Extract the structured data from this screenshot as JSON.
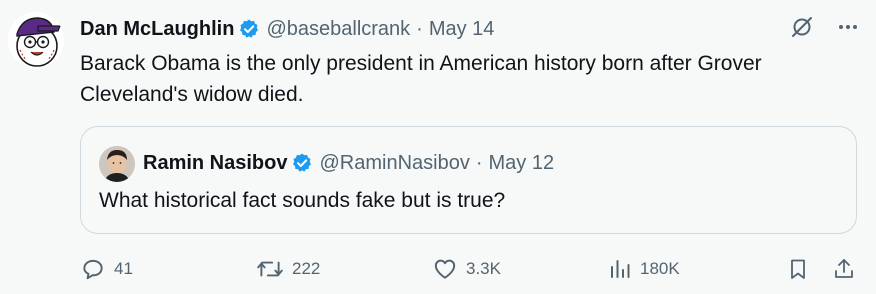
{
  "tweet": {
    "author_name": "Dan McLaughlin",
    "author_handle": "@baseballcrank",
    "separator": "·",
    "date": "May 14",
    "text": "Barack Obama is the only president in American history born after Grover Cleveland's widow died."
  },
  "quoted_tweet": {
    "author_name": "Ramin Nasibov",
    "author_handle": "@RaminNasibov",
    "separator": "·",
    "date": "May 12",
    "text": "What historical fact sounds fake but is true?"
  },
  "actions": {
    "replies": "41",
    "reposts": "222",
    "likes": "3.3K",
    "views": "180K"
  },
  "icons": {
    "verified": "verified-badge-icon",
    "grok": "grok-icon",
    "more": "more-icon",
    "reply": "reply-icon",
    "repost": "repost-icon",
    "like": "heart-icon",
    "views": "views-icon",
    "bookmark": "bookmark-icon",
    "share": "share-icon"
  },
  "colors": {
    "text": "#0f1419",
    "secondary": "#536471",
    "verified": "#1d9bf0",
    "background": "#f7f9f9",
    "border": "#cfd9de"
  }
}
